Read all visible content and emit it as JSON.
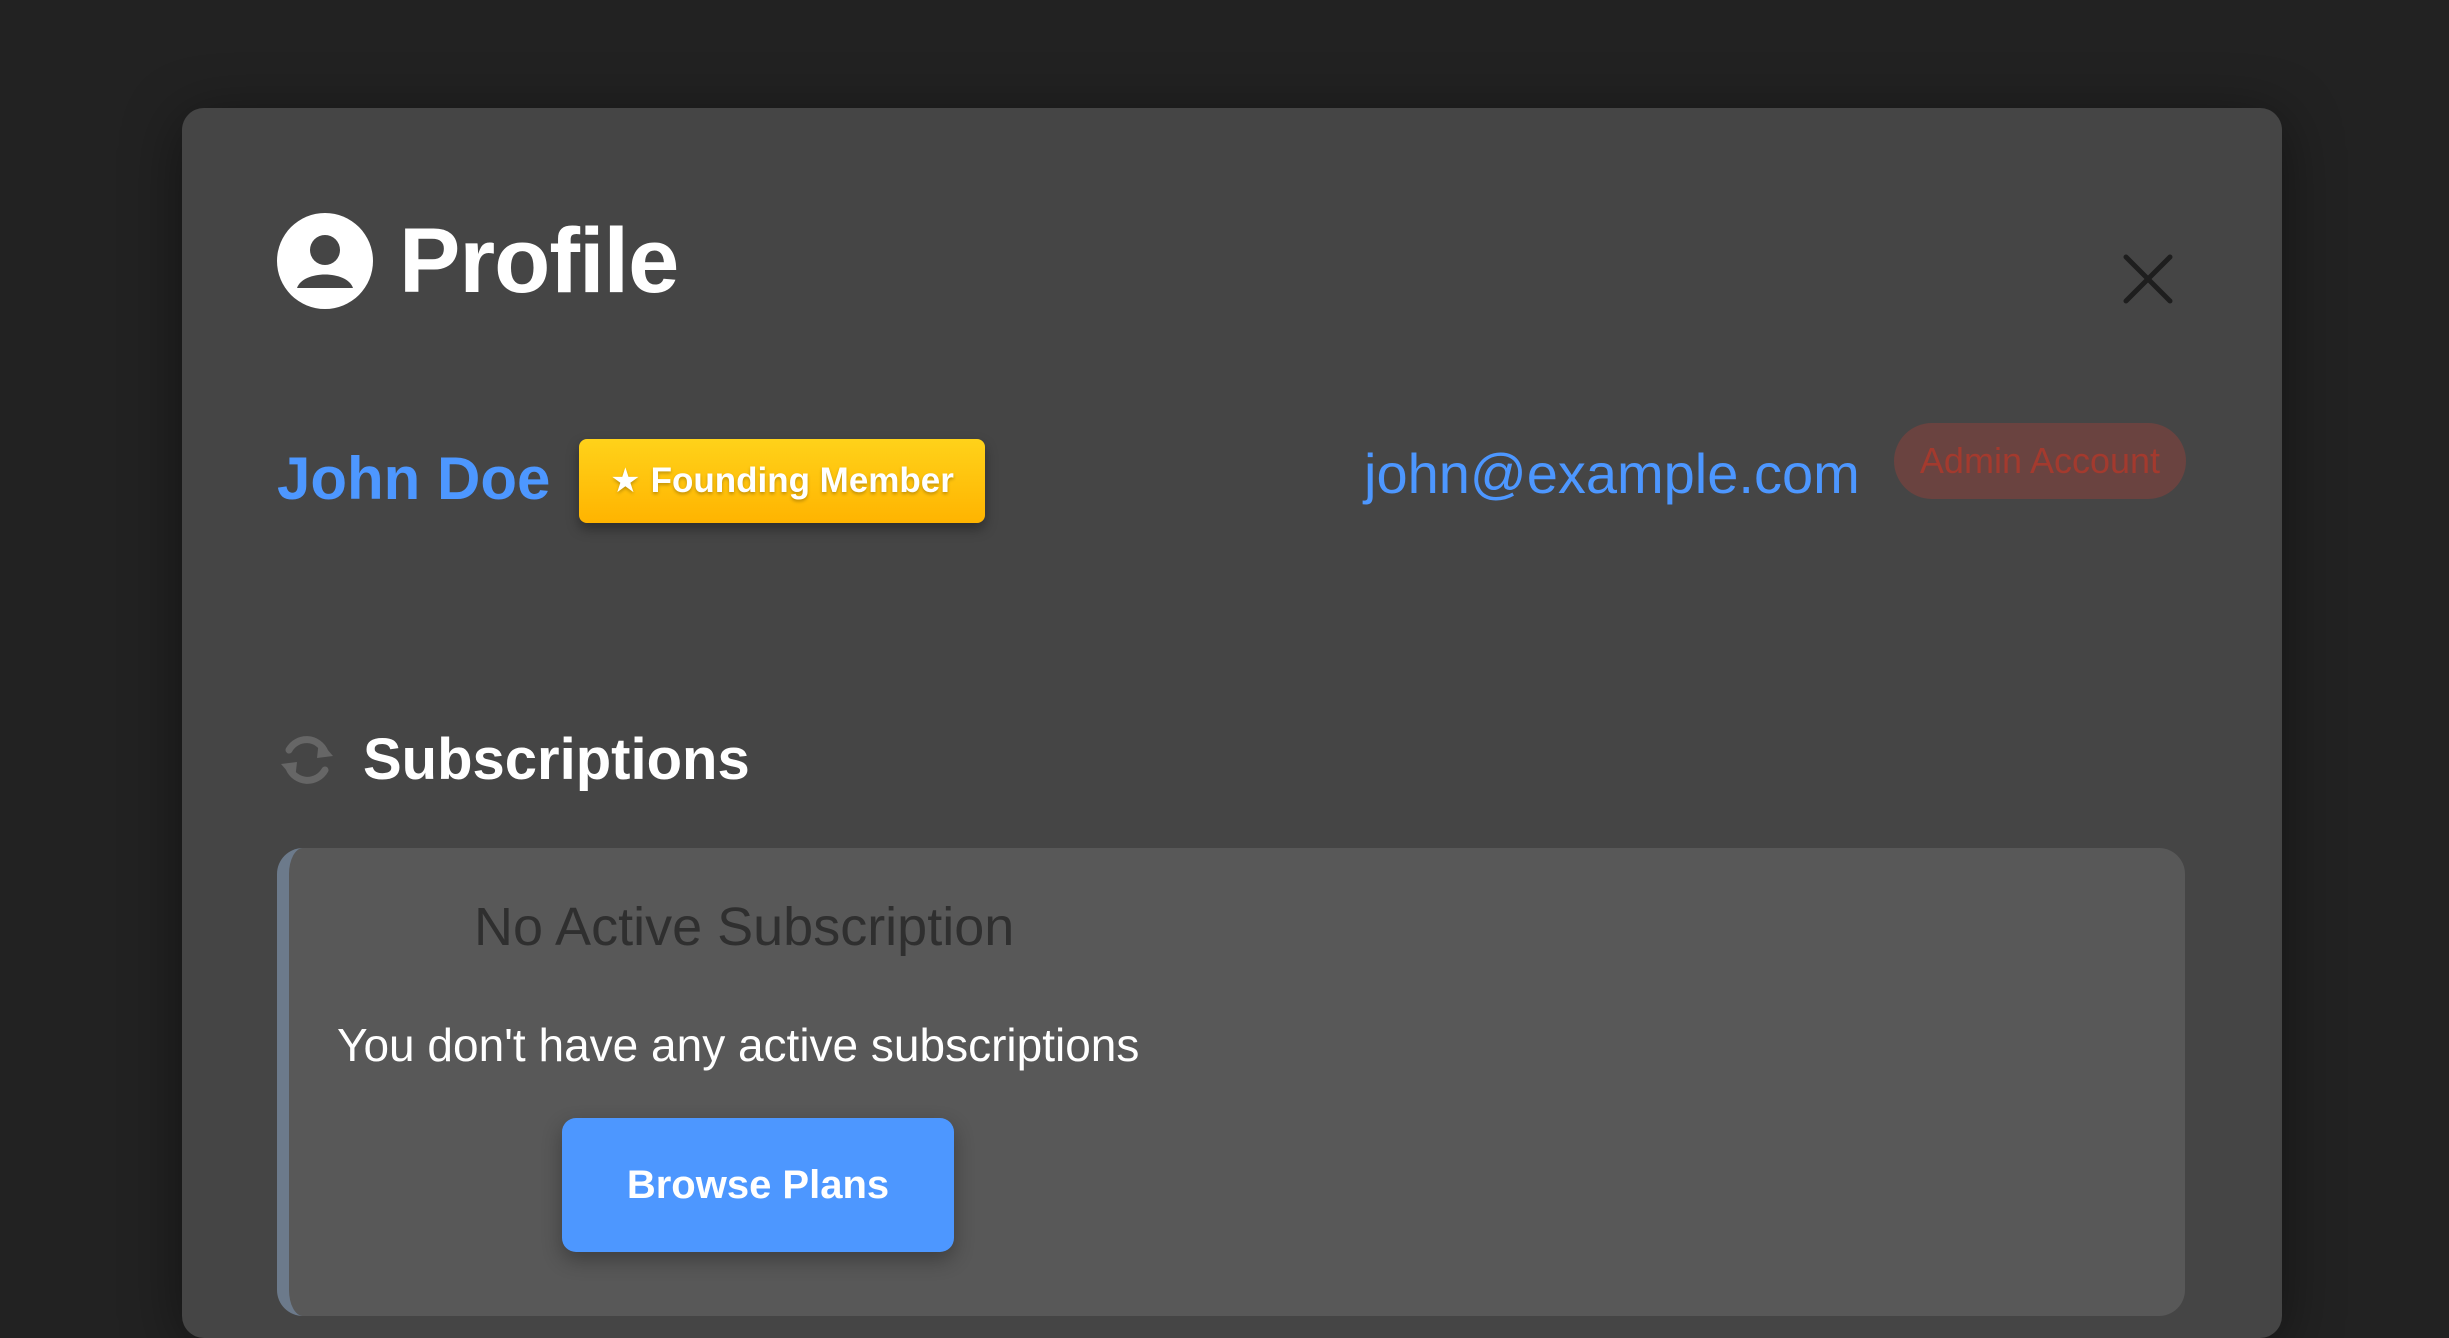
{
  "modal": {
    "title": "Profile",
    "icons": {
      "title_icon": "user-circle-icon",
      "close_icon": "close-icon"
    }
  },
  "user": {
    "name": "John Doe",
    "founder_badge": "Founding Member",
    "founder_badge_icon": "star-icon",
    "email": "john@example.com",
    "admin_badge": "Admin Account"
  },
  "subscriptions": {
    "section_title": "Subscriptions",
    "section_icon": "sync-icon",
    "empty_title": "No Active Subscription",
    "empty_description": "You don't have any active subscriptions",
    "browse_button": "Browse Plans"
  },
  "colors": {
    "accent": "#4d97ff",
    "modal_bg": "#454545",
    "page_bg": "#222222",
    "card_bg": "#585858",
    "founder_badge": "#ffc20e",
    "admin_badge_bg": "#6a4340",
    "admin_badge_text": "#a33a2e"
  }
}
